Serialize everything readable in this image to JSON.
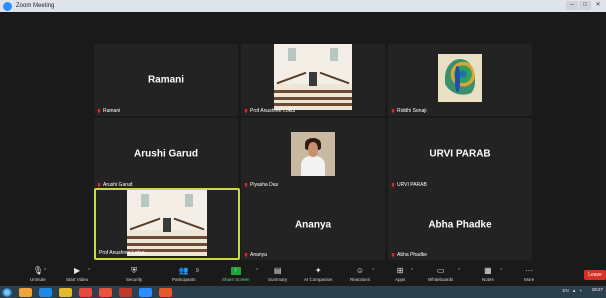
{
  "window": {
    "title": "Zoom Meeting",
    "minimize": "–",
    "maximize": "□",
    "close": "✕"
  },
  "view_button": {
    "label": "Vi"
  },
  "participants": [
    {
      "display_name": "Ramani",
      "label": "Ramani",
      "muted": true,
      "video": "off"
    },
    {
      "display_name": "",
      "label": "Prof Anushree Lokur",
      "muted": true,
      "video": "stairs"
    },
    {
      "display_name": "",
      "label": "Riddhi Sonaji",
      "muted": true,
      "video": "peacock"
    },
    {
      "display_name": "Arushi Garud",
      "label": "Arushi Garud",
      "muted": true,
      "video": "off"
    },
    {
      "display_name": "",
      "label": "Piyasha Das",
      "muted": true,
      "video": "portrait"
    },
    {
      "display_name": "URVI PARAB",
      "label": "URVI PARAB",
      "muted": true,
      "video": "off"
    },
    {
      "display_name": "",
      "label": "Prof Anushree Lokur",
      "muted": false,
      "video": "stairs",
      "active": true
    },
    {
      "display_name": "Ananya",
      "label": "Ananya",
      "muted": true,
      "video": "off"
    },
    {
      "display_name": "Abha Phadke",
      "label": "Abha Phadke",
      "muted": true,
      "video": "off"
    }
  ],
  "toolbar": {
    "unmute": "Unmute",
    "start_video": "Start Video",
    "security": "Security",
    "participants": "Participants",
    "participants_count": "9",
    "share_screen": "Share Screen",
    "summary": "Summary",
    "ai_companion": "AI Companion",
    "reactions": "Reactions",
    "apps": "Apps",
    "whiteboards": "Whiteboards",
    "notes": "Notes",
    "more": "More",
    "leave": "Leave"
  },
  "taskbar": {
    "tray": "EN",
    "time": "18:27",
    "colors": [
      "#f0a33a",
      "#1e88e5",
      "#e4b92b",
      "#e44b3a",
      "#e8533a",
      "#2d8cff",
      "#e55a2b"
    ]
  }
}
